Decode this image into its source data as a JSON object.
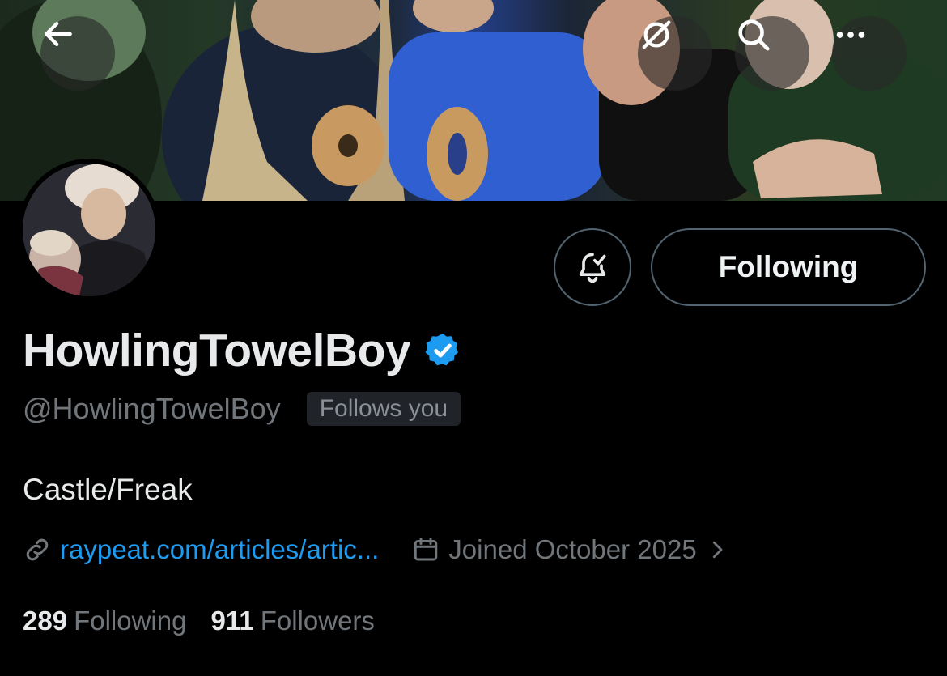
{
  "header": {
    "back_icon": "arrow-left-icon",
    "grok_icon": "grok-icon",
    "search_icon": "search-icon",
    "more_icon": "more-horizontal-icon"
  },
  "profile": {
    "display_name": "HowlingTowelBoy",
    "verified": true,
    "handle": "@HowlingTowelBoy",
    "follows_you_label": "Follows you",
    "bio": "Castle/Freak",
    "link": "raypeat.com/articles/artic...",
    "joined": "Joined October 2025"
  },
  "actions": {
    "notification_icon": "bell-check-icon",
    "following_label": "Following"
  },
  "stats": {
    "following_count": "289",
    "following_label": "Following",
    "followers_count": "911",
    "followers_label": "Followers"
  },
  "colors": {
    "accent": "#1d9bf0",
    "muted_text": "#71767b",
    "border": "#536471",
    "background": "#000000"
  }
}
